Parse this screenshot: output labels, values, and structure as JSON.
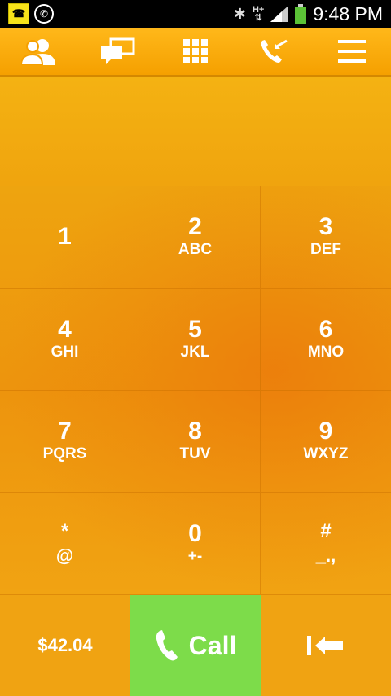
{
  "status_bar": {
    "time": "9:48 PM",
    "network": "H+",
    "icons": [
      "app-notification-icon",
      "whatsapp-icon",
      "bluetooth-icon",
      "network-h-plus-icon",
      "signal-icon",
      "battery-icon"
    ]
  },
  "toolbar": {
    "items": [
      {
        "name": "contacts",
        "icon": "contacts-icon"
      },
      {
        "name": "messages",
        "icon": "chat-icon"
      },
      {
        "name": "dialpad",
        "icon": "dialpad-icon"
      },
      {
        "name": "call-log",
        "icon": "call-log-icon"
      },
      {
        "name": "menu",
        "icon": "menu-icon"
      }
    ]
  },
  "display": {
    "number": ""
  },
  "keypad": [
    {
      "digit": "1",
      "letters": ""
    },
    {
      "digit": "2",
      "letters": "ABC"
    },
    {
      "digit": "3",
      "letters": "DEF"
    },
    {
      "digit": "4",
      "letters": "GHI"
    },
    {
      "digit": "5",
      "letters": "JKL"
    },
    {
      "digit": "6",
      "letters": "MNO"
    },
    {
      "digit": "7",
      "letters": "PQRS"
    },
    {
      "digit": "8",
      "letters": "TUV"
    },
    {
      "digit": "9",
      "letters": "WXYZ"
    },
    {
      "digit": "*",
      "letters": "@"
    },
    {
      "digit": "0",
      "letters": "+-"
    },
    {
      "digit": "#",
      "letters": "_.,"
    }
  ],
  "bottom": {
    "balance": "$42.04",
    "call_label": "Call"
  },
  "colors": {
    "primary_orange": "#f0a312",
    "call_green": "#7ddc4a",
    "status_bar": "#000000"
  }
}
